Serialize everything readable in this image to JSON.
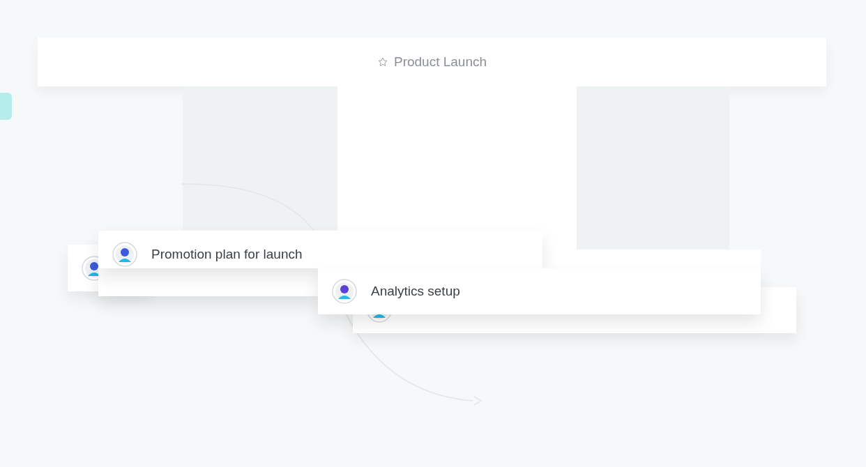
{
  "header": {
    "title": "Product Launch",
    "starred": false
  },
  "cards": [
    {
      "title": "Promotion plan for launch"
    },
    {
      "title": "Analytics setup"
    }
  ]
}
